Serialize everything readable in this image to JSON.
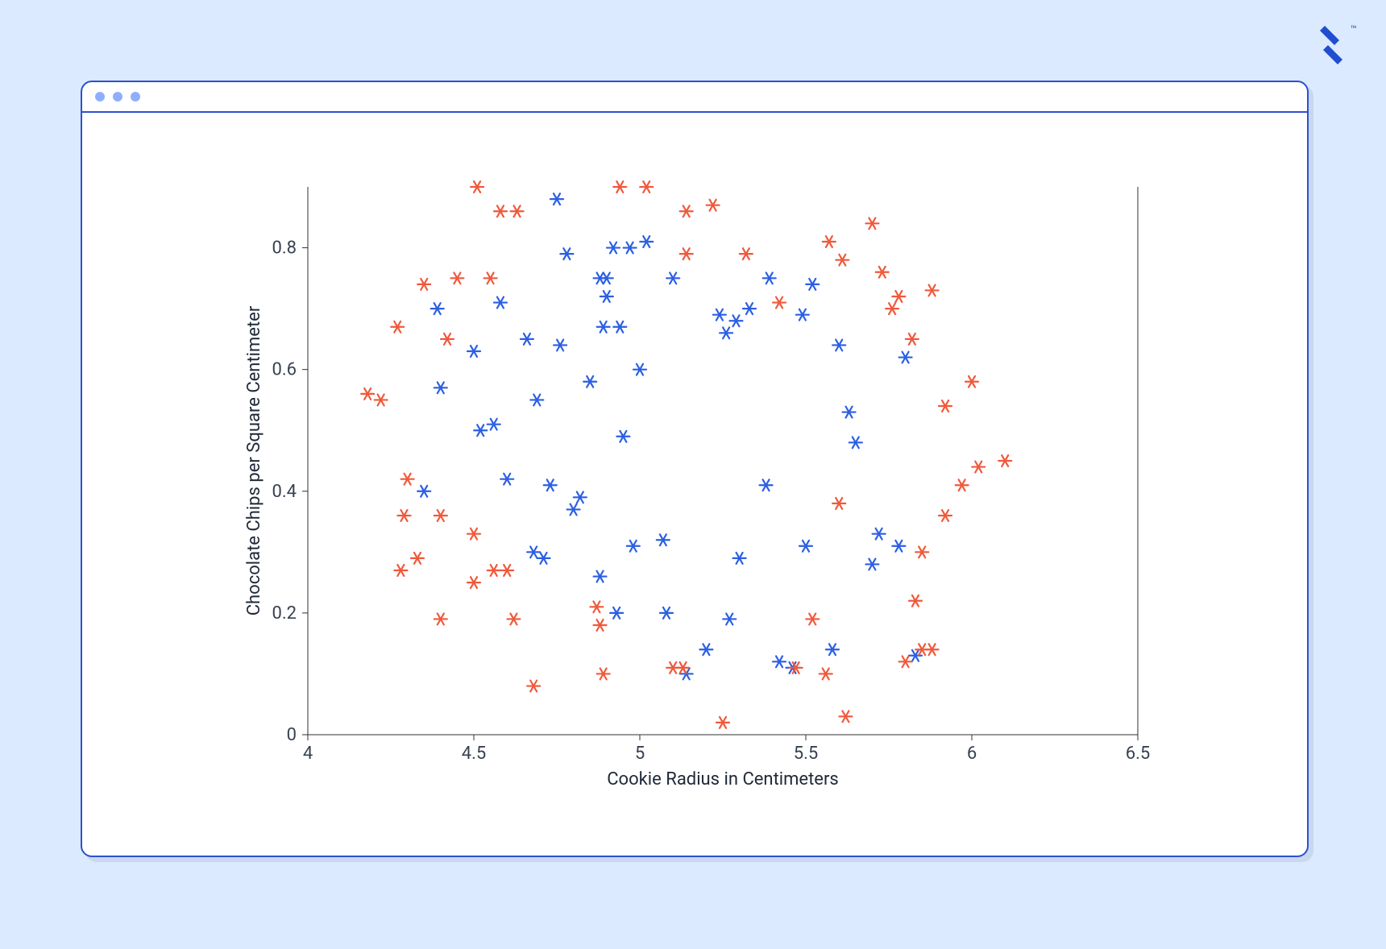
{
  "logo": {
    "name": "toptal-logo",
    "tm": "™"
  },
  "chart_data": {
    "type": "scatter",
    "xlabel": "Cookie Radius in Centimeters",
    "ylabel": "Chocolate Chips per Square Centimeter",
    "xlim": [
      4,
      6.5
    ],
    "ylim": [
      0,
      0.9
    ],
    "xticks": [
      4,
      4.5,
      5,
      5.5,
      6,
      6.5
    ],
    "yticks": [
      0,
      0.2,
      0.4,
      0.6,
      0.8
    ],
    "series": [
      {
        "name": "blue",
        "color": "#2b5fe3",
        "points": [
          [
            4.35,
            0.4
          ],
          [
            4.39,
            0.7
          ],
          [
            4.4,
            0.57
          ],
          [
            4.5,
            0.63
          ],
          [
            4.52,
            0.5
          ],
          [
            4.56,
            0.51
          ],
          [
            4.58,
            0.71
          ],
          [
            4.6,
            0.42
          ],
          [
            4.66,
            0.65
          ],
          [
            4.68,
            0.3
          ],
          [
            4.69,
            0.55
          ],
          [
            4.71,
            0.29
          ],
          [
            4.73,
            0.41
          ],
          [
            4.75,
            0.88
          ],
          [
            4.76,
            0.64
          ],
          [
            4.78,
            0.79
          ],
          [
            4.8,
            0.37
          ],
          [
            4.82,
            0.39
          ],
          [
            4.85,
            0.58
          ],
          [
            4.88,
            0.75
          ],
          [
            4.88,
            0.26
          ],
          [
            4.89,
            0.67
          ],
          [
            4.9,
            0.75
          ],
          [
            4.9,
            0.72
          ],
          [
            4.92,
            0.8
          ],
          [
            4.93,
            0.2
          ],
          [
            4.94,
            0.67
          ],
          [
            4.95,
            0.49
          ],
          [
            4.97,
            0.8
          ],
          [
            4.98,
            0.31
          ],
          [
            5.0,
            0.6
          ],
          [
            5.02,
            0.81
          ],
          [
            5.07,
            0.32
          ],
          [
            5.08,
            0.2
          ],
          [
            5.1,
            0.75
          ],
          [
            5.14,
            0.1
          ],
          [
            5.2,
            0.14
          ],
          [
            5.24,
            0.69
          ],
          [
            5.26,
            0.66
          ],
          [
            5.27,
            0.19
          ],
          [
            5.29,
            0.68
          ],
          [
            5.3,
            0.29
          ],
          [
            5.33,
            0.7
          ],
          [
            5.38,
            0.41
          ],
          [
            5.39,
            0.75
          ],
          [
            5.42,
            0.12
          ],
          [
            5.46,
            0.11
          ],
          [
            5.49,
            0.69
          ],
          [
            5.5,
            0.31
          ],
          [
            5.52,
            0.74
          ],
          [
            5.58,
            0.14
          ],
          [
            5.6,
            0.64
          ],
          [
            5.63,
            0.53
          ],
          [
            5.65,
            0.48
          ],
          [
            5.7,
            0.28
          ],
          [
            5.72,
            0.33
          ],
          [
            5.78,
            0.31
          ],
          [
            5.8,
            0.62
          ],
          [
            5.83,
            0.13
          ]
        ]
      },
      {
        "name": "orange",
        "color": "#f0593b",
        "points": [
          [
            4.18,
            0.56
          ],
          [
            4.22,
            0.55
          ],
          [
            4.27,
            0.67
          ],
          [
            4.28,
            0.27
          ],
          [
            4.29,
            0.36
          ],
          [
            4.3,
            0.42
          ],
          [
            4.33,
            0.29
          ],
          [
            4.35,
            0.74
          ],
          [
            4.4,
            0.36
          ],
          [
            4.4,
            0.19
          ],
          [
            4.42,
            0.65
          ],
          [
            4.45,
            0.75
          ],
          [
            4.5,
            0.33
          ],
          [
            4.5,
            0.25
          ],
          [
            4.51,
            0.9
          ],
          [
            4.55,
            0.75
          ],
          [
            4.56,
            0.27
          ],
          [
            4.58,
            0.86
          ],
          [
            4.6,
            0.27
          ],
          [
            4.62,
            0.19
          ],
          [
            4.63,
            0.86
          ],
          [
            4.68,
            0.08
          ],
          [
            4.87,
            0.21
          ],
          [
            4.88,
            0.18
          ],
          [
            4.89,
            0.1
          ],
          [
            4.94,
            0.9
          ],
          [
            5.02,
            0.9
          ],
          [
            5.1,
            0.11
          ],
          [
            5.13,
            0.11
          ],
          [
            5.14,
            0.79
          ],
          [
            5.14,
            0.86
          ],
          [
            5.22,
            0.87
          ],
          [
            5.25,
            0.02
          ],
          [
            5.32,
            0.79
          ],
          [
            5.42,
            0.71
          ],
          [
            5.47,
            0.11
          ],
          [
            5.52,
            0.19
          ],
          [
            5.56,
            0.1
          ],
          [
            5.57,
            0.81
          ],
          [
            5.6,
            0.38
          ],
          [
            5.61,
            0.78
          ],
          [
            5.62,
            0.03
          ],
          [
            5.7,
            0.84
          ],
          [
            5.73,
            0.76
          ],
          [
            5.76,
            0.7
          ],
          [
            5.78,
            0.72
          ],
          [
            5.8,
            0.12
          ],
          [
            5.82,
            0.65
          ],
          [
            5.83,
            0.22
          ],
          [
            5.85,
            0.14
          ],
          [
            5.85,
            0.3
          ],
          [
            5.88,
            0.73
          ],
          [
            5.88,
            0.14
          ],
          [
            5.92,
            0.36
          ],
          [
            5.92,
            0.54
          ],
          [
            5.97,
            0.41
          ],
          [
            6.0,
            0.58
          ],
          [
            6.02,
            0.44
          ],
          [
            6.1,
            0.45
          ]
        ]
      }
    ]
  }
}
